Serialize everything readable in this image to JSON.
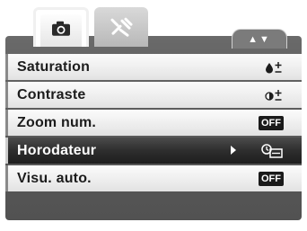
{
  "tabs": [
    {
      "icon": "camera-icon",
      "active": true
    },
    {
      "icon": "tools-icon",
      "active": false
    }
  ],
  "scroll_indicator": "▲▼",
  "menu": {
    "items": [
      {
        "label": "Saturation",
        "value_icon": "saturation-icon"
      },
      {
        "label": "Contraste",
        "value_icon": "contrast-icon"
      },
      {
        "label": "Zoom num.",
        "value_text": "OFF"
      },
      {
        "label": "Horodateur",
        "value_icon": "date-stamp-icon",
        "selected": true
      },
      {
        "label": "Visu. auto.",
        "value_text": "OFF"
      }
    ]
  }
}
